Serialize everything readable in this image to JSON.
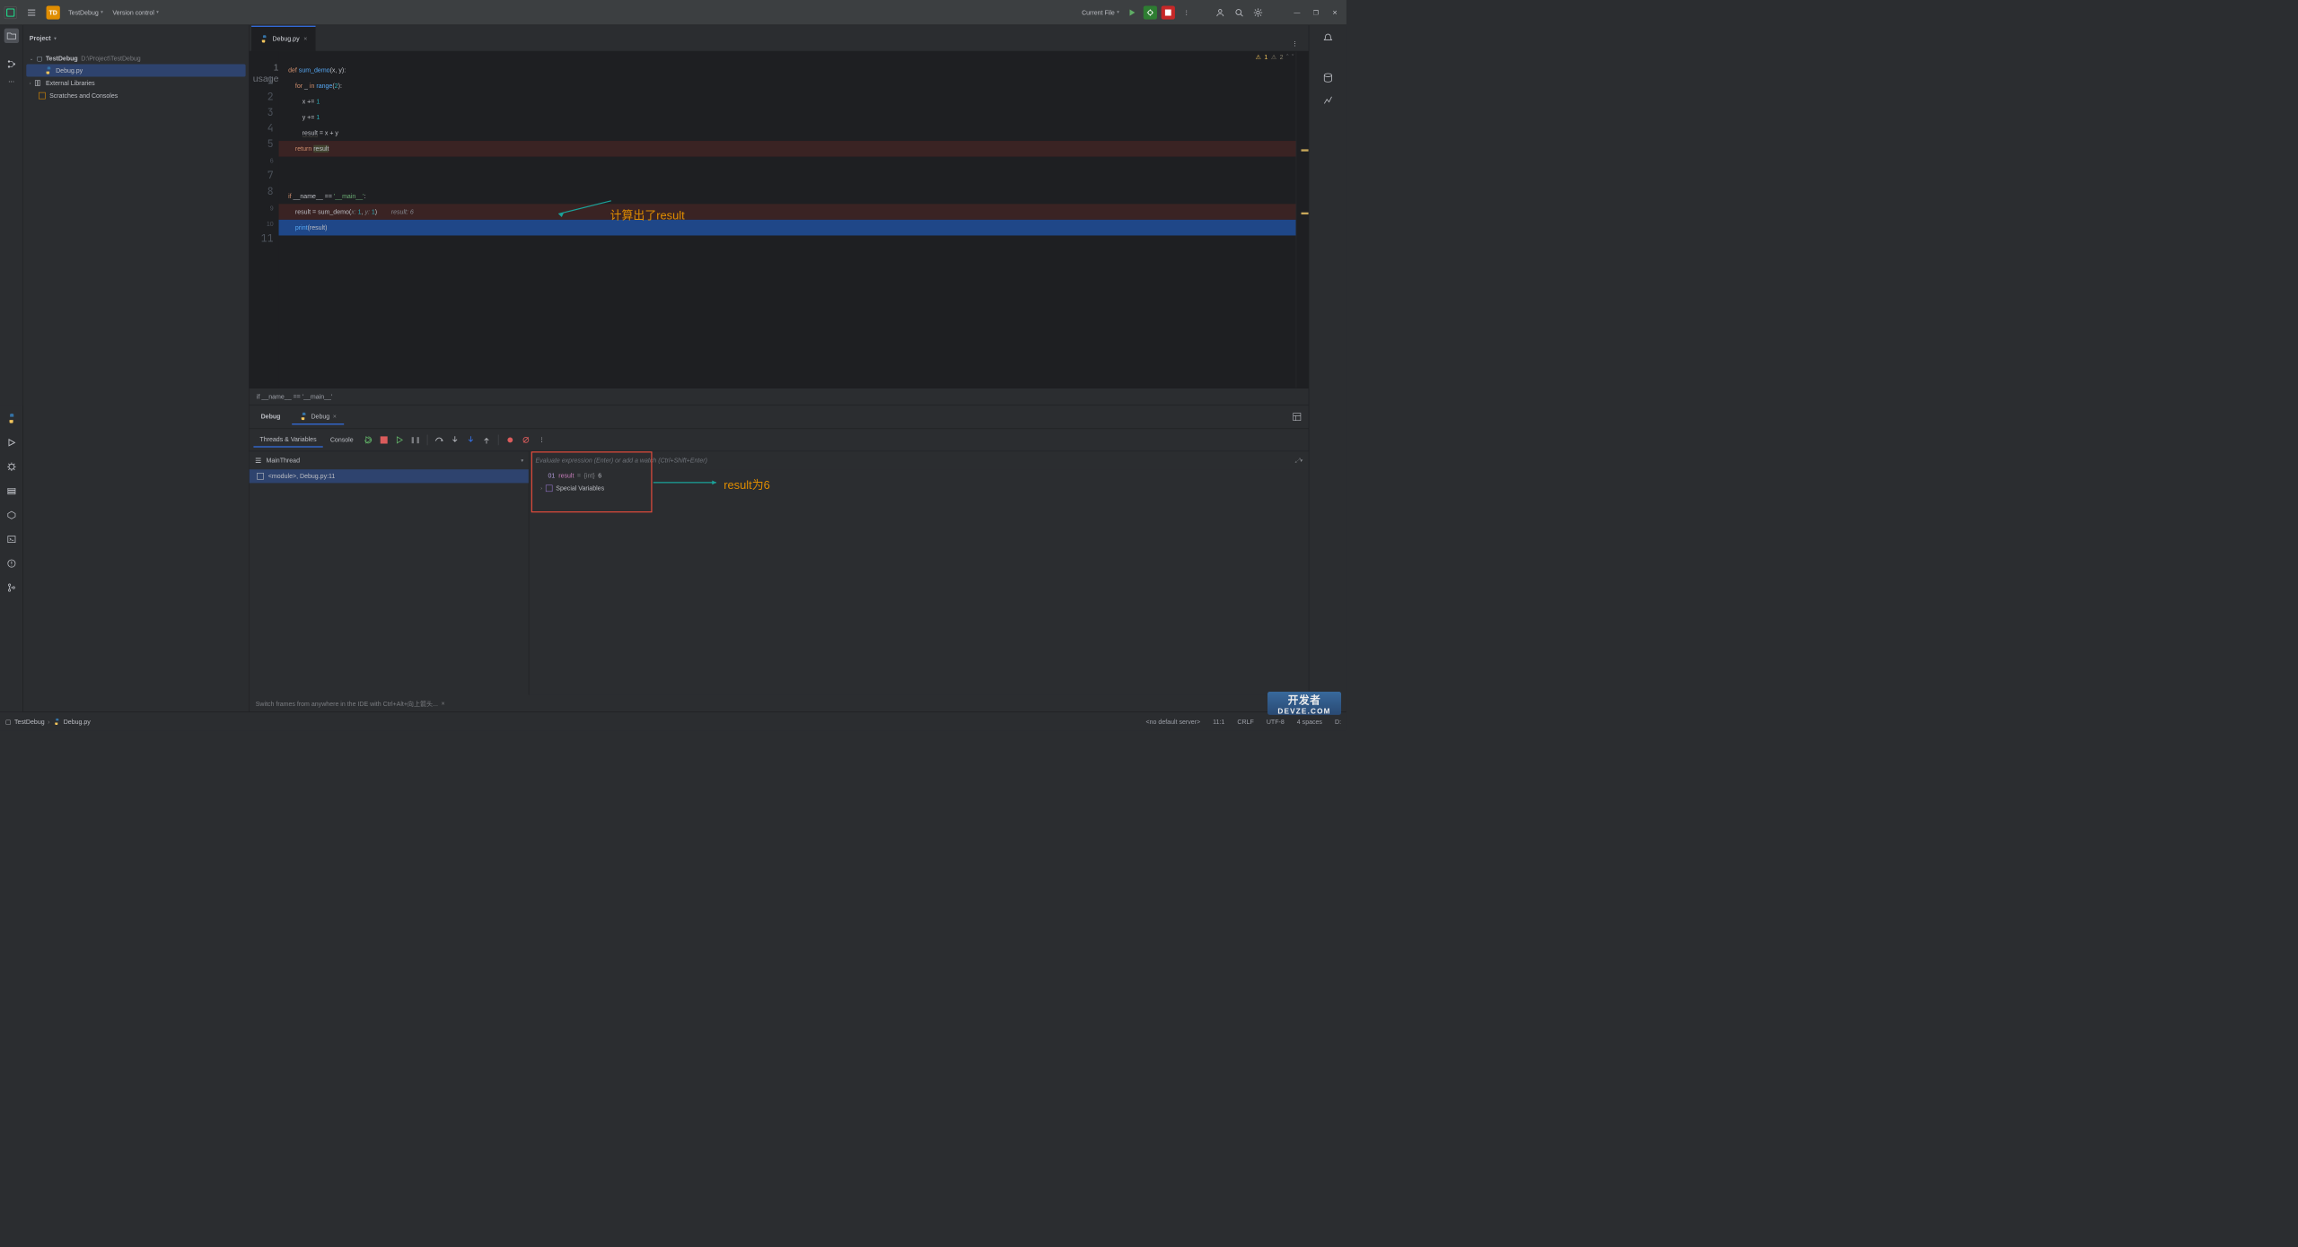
{
  "titlebar": {
    "project_badge": "TD",
    "project_name": "TestDebug",
    "vcs_label": "Version control",
    "run_config": "Current File"
  },
  "project_tool": {
    "title": "Project",
    "root_name": "TestDebug",
    "root_path": "D:\\Project\\TestDebug",
    "file_debug": "Debug.py",
    "external_libs": "External Libraries",
    "scratches": "Scratches and Consoles"
  },
  "editor": {
    "tab_name": "Debug.py",
    "usage_hint": "1 usage",
    "warn_count1": "1",
    "warn_count2": "2",
    "lines": {
      "l1": "def sum_demo(x, y):",
      "l2": "    for _ in range(2):",
      "l3": "        x += 1",
      "l4": "        y += 1",
      "l5": "        result = x + y",
      "l6": "    return result",
      "l7": "",
      "l8": "",
      "l9": "if __name__ == '__main__':",
      "l10_pre": "    result = sum_demo(",
      "l10_hint_x": "x: ",
      "l10_v1": "1",
      "l10_comma": ", ",
      "l10_hint_y": "y: ",
      "l10_v2": "1",
      "l10_close": ")",
      "l10_inlay": "  result: 6",
      "l11": "    print(result)"
    },
    "line_numbers": [
      "1",
      "2",
      "3",
      "4",
      "5",
      "6",
      "7",
      "8",
      "9",
      "10",
      "11"
    ],
    "breadcrumb": "if __name__ == '__main__'",
    "annotation1": "计算出了result"
  },
  "debug": {
    "panel_title": "Debug",
    "config_name": "Debug",
    "sub_tab_threads": "Threads & Variables",
    "sub_tab_console": "Console",
    "thread_name": "MainThread",
    "frame_label": "<module>, Debug.py:11",
    "eval_placeholder": "Evaluate expression (Enter) or add a watch (Ctrl+Shift+Enter)",
    "var_result_name": "result",
    "var_result_eq": " = ",
    "var_result_type": "{int}",
    "var_result_val": " 6",
    "special_vars": "Special Variables",
    "annotation2": "result为6",
    "hint": "Switch frames from anywhere in the IDE with Ctrl+Alt+向上箭头..."
  },
  "status": {
    "crumb_project": "TestDebug",
    "crumb_file": "Debug.py",
    "server": "<no default server>",
    "pos": "11:1",
    "eol": "CRLF",
    "enc": "UTF-8",
    "indent": "4 spaces",
    "branch_prefix": "D:"
  },
  "watermark": {
    "line1": "开发者",
    "line2": "DEVZE.COM"
  }
}
